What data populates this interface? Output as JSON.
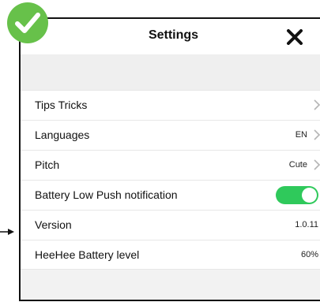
{
  "header": {
    "title": "Settings"
  },
  "rows": [
    {
      "label": "Tips Tricks",
      "value": ""
    },
    {
      "label": "Languages",
      "value": "EN"
    },
    {
      "label": "Pitch",
      "value": "Cute"
    },
    {
      "label": "Battery Low Push notification",
      "toggle": true
    },
    {
      "label": "Version",
      "value": "1.0.11"
    },
    {
      "label": "HeeHee Battery level",
      "value": "60%"
    }
  ],
  "colors": {
    "toggle_on": "#2fc95b",
    "badge": "#67c14a"
  },
  "icons": [
    "check-circle-icon",
    "close-icon",
    "chevron-right-icon",
    "arrow-pointer-icon"
  ]
}
